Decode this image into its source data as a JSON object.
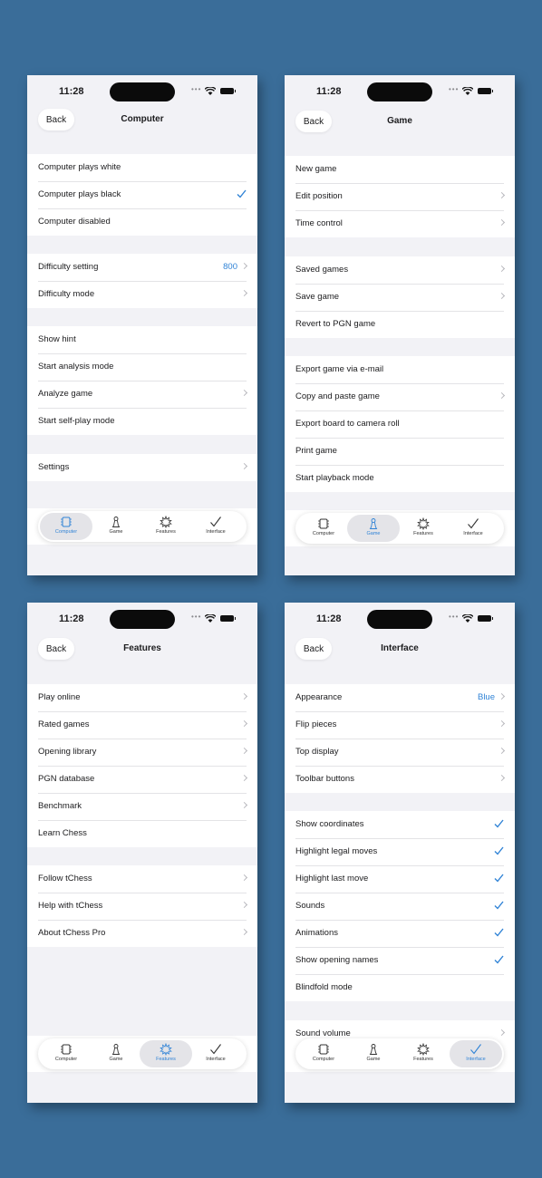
{
  "accent": "#3083d6",
  "status": {
    "time": "11:28"
  },
  "nav": {
    "back": "Back"
  },
  "tabs": {
    "computer": "Computer",
    "game": "Game",
    "features": "Features",
    "interface": "Interface"
  },
  "screens": {
    "computer": {
      "title": "Computer",
      "rows": {
        "plays_white": "Computer plays white",
        "plays_black": "Computer plays black",
        "disabled": "Computer disabled",
        "difficulty_setting": "Difficulty setting",
        "difficulty_value": "800",
        "difficulty_mode": "Difficulty mode",
        "show_hint": "Show hint",
        "analysis_mode": "Start analysis mode",
        "analyze_game": "Analyze game",
        "self_play": "Start self-play mode",
        "settings": "Settings"
      }
    },
    "game": {
      "title": "Game",
      "rows": {
        "new_game": "New game",
        "edit_position": "Edit position",
        "time_control": "Time control",
        "saved_games": "Saved games",
        "save_game": "Save game",
        "revert_pgn": "Revert to PGN game",
        "export_email": "Export game via e-mail",
        "copy_paste": "Copy and paste game",
        "export_camera": "Export board to camera roll",
        "print_game": "Print game",
        "playback_mode": "Start playback mode"
      }
    },
    "features": {
      "title": "Features",
      "rows": {
        "play_online": "Play online",
        "rated_games": "Rated games",
        "opening_library": "Opening library",
        "pgn_database": "PGN database",
        "benchmark": "Benchmark",
        "learn_chess": "Learn Chess",
        "follow": "Follow tChess",
        "help": "Help with tChess",
        "about": "About tChess Pro"
      }
    },
    "interface": {
      "title": "Interface",
      "rows": {
        "appearance": "Appearance",
        "appearance_value": "Blue",
        "flip_pieces": "Flip pieces",
        "top_display": "Top display",
        "toolbar_buttons": "Toolbar buttons",
        "show_coordinates": "Show coordinates",
        "highlight_legal": "Highlight legal moves",
        "highlight_last": "Highlight last move",
        "sounds": "Sounds",
        "animations": "Animations",
        "opening_names": "Show opening names",
        "blindfold": "Blindfold mode",
        "sound_volume": "Sound volume"
      }
    }
  }
}
